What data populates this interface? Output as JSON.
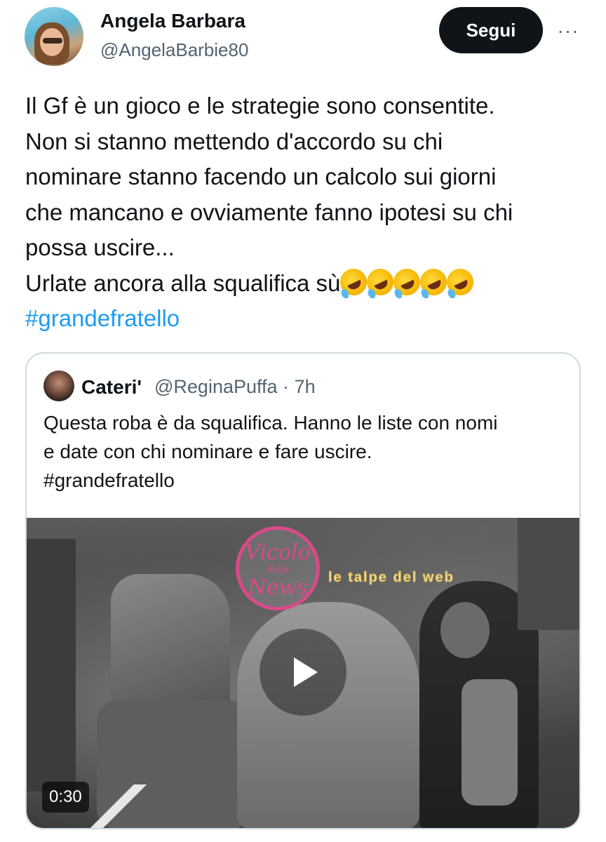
{
  "author": {
    "name": "Angela Barbara",
    "handle": "@AngelaBarbie80"
  },
  "actions": {
    "follow_label": "Segui",
    "more_label": "···"
  },
  "tweet": {
    "lines": [
      "Il Gf è un gioco e le strategie sono consentite.",
      "Non si stanno mettendo d'accordo su chi",
      "nominare stanno facendo un calcolo sui giorni",
      "che mancano e ovviamente fanno ipotesi su chi",
      "possa uscire...",
      "Urlate ancora alla squalifica sù"
    ],
    "emoji": "rolling-on-the-floor-laughing-icon",
    "emoji_count": 5,
    "hashtag": "#grandefratello"
  },
  "quoted": {
    "name": "Cateri'",
    "handle": "@ReginaPuffa",
    "time": "7h",
    "separator": "·",
    "lines": [
      "Questa roba è da squalifica. Hanno le liste con nomi",
      "e date con chi nominare e fare uscire.",
      "#grandefratello"
    ],
    "video": {
      "duration": "0:30",
      "watermark_circle_top": "Vicolo",
      "watermark_circle_mid": "delle",
      "watermark_circle_bottom": "News",
      "watermark_text": "le talpe del web"
    }
  },
  "colors": {
    "text": "#0f1419",
    "secondary": "#536471",
    "link": "#1d9bf0",
    "button": "#0f1419",
    "border": "#cfd9de"
  }
}
